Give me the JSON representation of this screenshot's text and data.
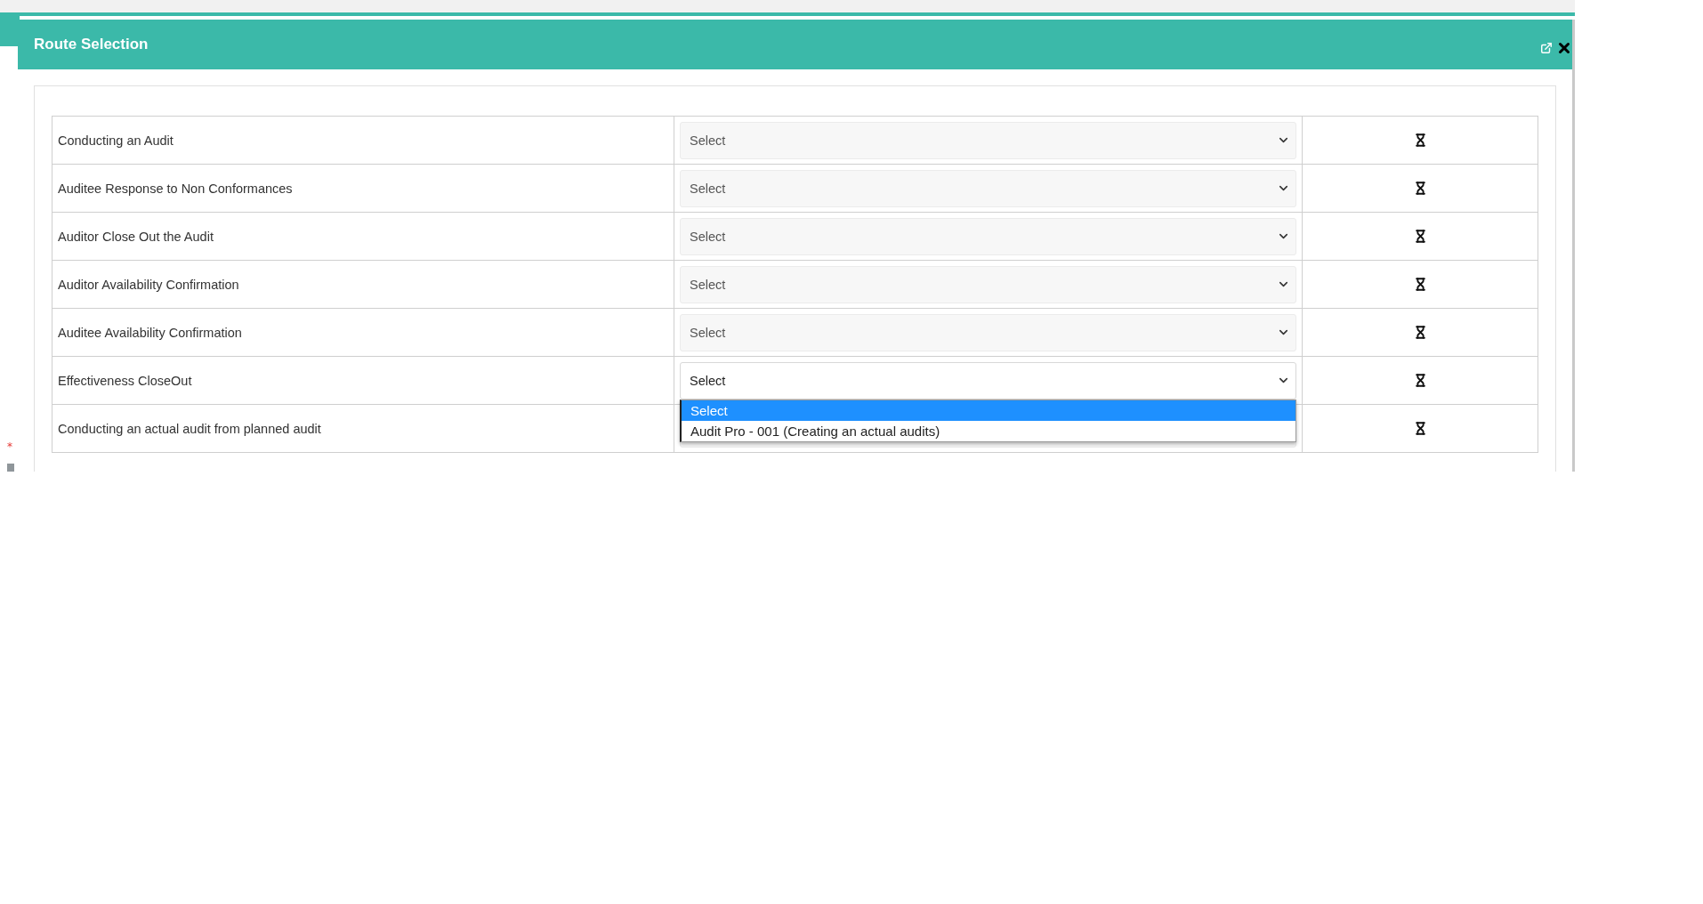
{
  "dialog": {
    "title": "Route Selection"
  },
  "rows": [
    {
      "label": "Conducting an Audit",
      "select_value": "Select",
      "open": false
    },
    {
      "label": "Auditee Response to Non Conformances",
      "select_value": "Select",
      "open": false
    },
    {
      "label": "Auditor Close Out the Audit",
      "select_value": "Select",
      "open": false
    },
    {
      "label": "Auditor Availability Confirmation",
      "select_value": "Select",
      "open": false
    },
    {
      "label": "Auditee Availability Confirmation",
      "select_value": "Select",
      "open": false
    },
    {
      "label": "Effectiveness CloseOut",
      "select_value": "Select",
      "open": true,
      "options": [
        {
          "label": "Select",
          "selected": true
        },
        {
          "label": "Audit Pro - 001 (Creating an actual audits)",
          "selected": false
        }
      ]
    },
    {
      "label": "Conducting an actual audit from planned audit",
      "open": false
    }
  ],
  "required_mark": "*"
}
